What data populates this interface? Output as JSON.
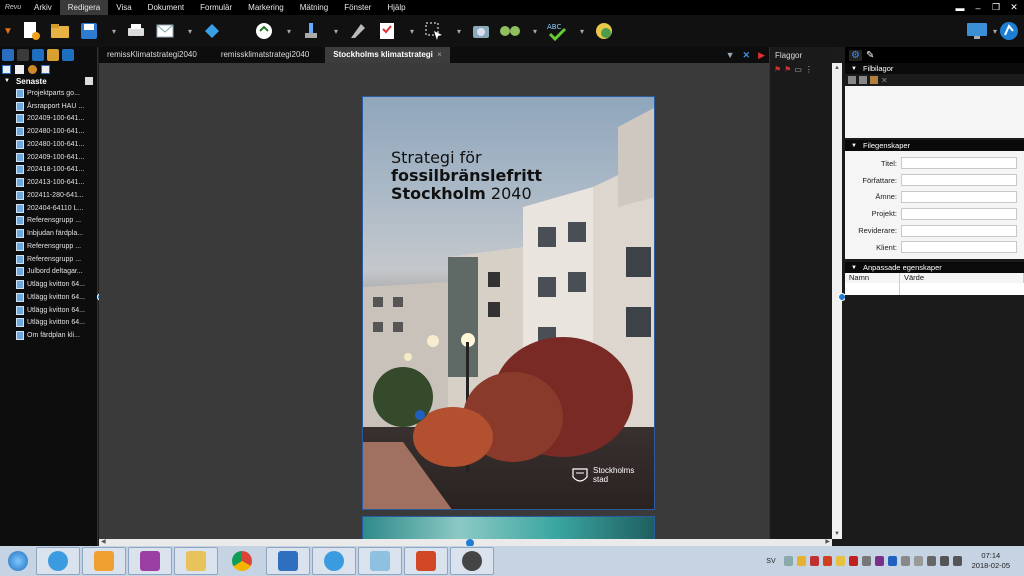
{
  "app": {
    "logo_text": "Revu"
  },
  "menu": {
    "items": [
      "Arkiv",
      "Redigera",
      "Visa",
      "Dokument",
      "Formulär",
      "Markering",
      "Mätning",
      "Fönster",
      "Hjälp"
    ],
    "active": "Redigera"
  },
  "window_controls": {
    "minimize": "–",
    "restore": "❐",
    "close": "✕",
    "extra": "▬"
  },
  "toolbar": {
    "icons": [
      "new-file-icon",
      "open-folder-icon",
      "save-icon",
      "print-icon",
      "email-icon",
      "share-icon",
      "zoom-select-icon",
      "stamp-icon",
      "pen-icon",
      "checklist-icon",
      "select-icon",
      "snapshot-icon",
      "binoculars-icon",
      "spellcheck-icon",
      "globe-icon"
    ]
  },
  "left_panel": {
    "section_title": "Senaste",
    "recent_files": [
      "Projektparts go...",
      "Årsrapport HAU ...",
      "202409-100-641...",
      "202480-100-641...",
      "202480-100-641...",
      "202409-100-641...",
      "202418-100-641...",
      "202413-100-641...",
      "202411-280-641...",
      "202404-64110 L...",
      "Referensgrupp ...",
      "Inbjudan färdpla...",
      "Referensgrupp ...",
      "Referensgrupp ...",
      "Julbord deltagar...",
      "Utlägg kvitton 64...",
      "Utlägg kvitton 64...",
      "Utlägg kvitton 64...",
      "Utlägg kvitton 64...",
      "Om färdplan kli..."
    ]
  },
  "doc_tabs": {
    "tabs": [
      "remissKlimatstrategi2040",
      "remissklimatstrategi2040",
      "Stockholms klimatstrategi"
    ],
    "active_index": 2,
    "close_glyph": "×"
  },
  "document": {
    "cover_title_line1": "Strategi för",
    "cover_title_line2": "fossilbränslefritt",
    "cover_title_line3_bold": "Stockholm",
    "cover_title_line3_year": "2040",
    "logo_line1": "Stockholms",
    "logo_line2": "stad"
  },
  "flags_panel": {
    "title": "Flaggor"
  },
  "right_panel": {
    "attachments_title": "Filbilagor",
    "properties_title": "Filegenskaper",
    "properties": [
      {
        "label": "Titel:"
      },
      {
        "label": "Författare:"
      },
      {
        "label": "Ämne:"
      },
      {
        "label": "Projekt:"
      },
      {
        "label": "Reviderare:"
      },
      {
        "label": "Klient:"
      }
    ],
    "custom_title": "Anpassade egenskaper",
    "custom_columns": [
      "Namn",
      "Värde"
    ]
  },
  "taskbar": {
    "apps": [
      "ie-icon",
      "outlook-icon",
      "onenote-icon",
      "explorer-icon",
      "chrome-icon",
      "lync-icon",
      "ie-icon",
      "rdp-icon",
      "powerpoint-icon",
      "revu-icon"
    ],
    "language": "SV",
    "time": "07:14",
    "date": "2018-02-05"
  },
  "colors": {
    "accent": "#2a5aa0",
    "menubar": "#000000",
    "taskbar": "#c6d3e3"
  }
}
